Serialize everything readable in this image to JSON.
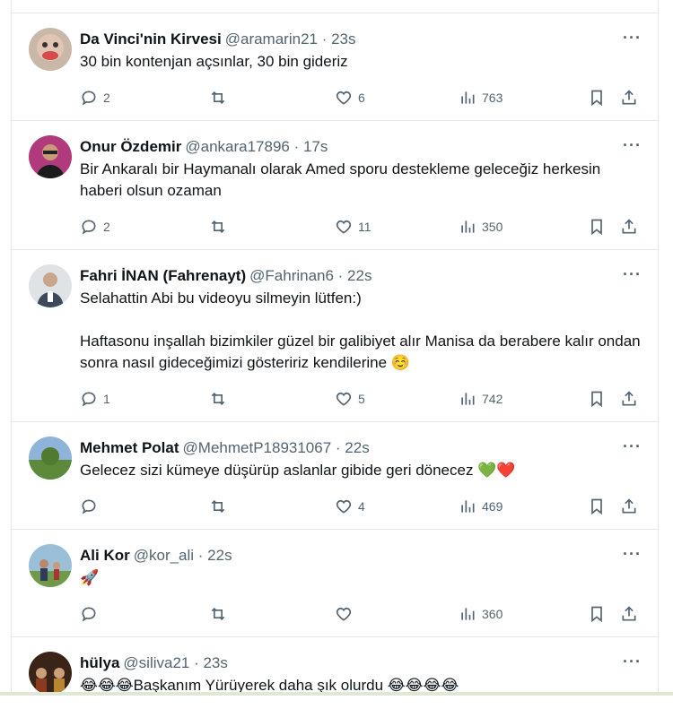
{
  "tweets": [
    {
      "name": "Da Vinci'nin Kirvesi",
      "meta": "@aramarin21 · 23s",
      "text": "30 bin kontenjan açsınlar, 30 bin gideriz",
      "replies": "2",
      "retweets": "",
      "likes": "6",
      "views": "763"
    },
    {
      "name": "Onur Özdemir",
      "meta": "@ankara17896 · 17s",
      "text": "Bir Ankaralı bir Haymanalı olarak Amed sporu destekleme geleceğiz herkesin haberi olsun ozaman",
      "replies": "2",
      "retweets": "",
      "likes": "11",
      "views": "350"
    },
    {
      "name": "Fahri İNAN (Fahrenayt)",
      "meta": "@Fahrinan6 · 22s",
      "text": "Selahattin Abi bu videoyu silmeyin lütfen:)\n\nHaftasonu inşallah bizimkiler güzel bir galibiyet alır Manisa da berabere kalır ondan sonra nasıl gideceğimizi gösteririz kendilerine ☺️",
      "replies": "1",
      "retweets": "",
      "likes": "5",
      "views": "742"
    },
    {
      "name": "Mehmet Polat",
      "meta": "@MehmetP18931067 · 22s",
      "text": "Gelecez sizi kümeye düşürüp aslanlar gibide geri dönecez 💚❤️",
      "replies": "",
      "retweets": "",
      "likes": "4",
      "views": "469"
    },
    {
      "name": "Ali Kor",
      "meta": "@kor_ali · 22s",
      "text": "🚀",
      "replies": "",
      "retweets": "",
      "likes": "",
      "views": "360"
    },
    {
      "name": "hülya",
      "meta": "@siliva21 · 23s",
      "text": "😂😂😂Başkanım Yürüyerek daha şık olurdu 😂😂😂😂",
      "replies": "",
      "retweets": "",
      "likes": "",
      "views": ""
    }
  ],
  "more_label": "···",
  "colors": {
    "text": "#0f1419",
    "muted": "#536471",
    "border": "#e6e9ea"
  }
}
